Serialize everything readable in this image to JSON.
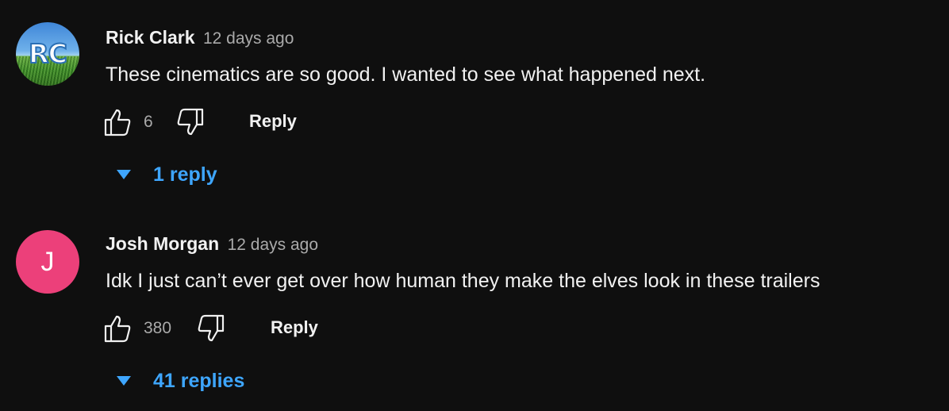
{
  "comments": [
    {
      "author": "Rick Clark",
      "time": "12 days ago",
      "text": "These cinematics are so good. I wanted to see what happened next.",
      "avatar_monogram": "RC",
      "likes": "6",
      "reply_label": "Reply",
      "replies_label": "1 reply",
      "like_icon": "thumbs-up-icon",
      "dislike_icon": "thumbs-down-icon",
      "toggle_icon": "caret-down-icon"
    },
    {
      "author": "Josh Morgan",
      "time": "12 days ago",
      "text": "Idk I just can’t ever get over how human they make the elves look in these trailers",
      "avatar_letter": "J",
      "avatar_color": "#ec407a",
      "likes": "380",
      "reply_label": "Reply",
      "replies_label": "41 replies",
      "like_icon": "thumbs-up-icon",
      "dislike_icon": "thumbs-down-icon",
      "toggle_icon": "caret-down-icon"
    }
  ],
  "colors": {
    "background": "#0f0f0f",
    "text_primary": "#f1f1f1",
    "text_secondary": "#aaaaaa",
    "link_blue": "#3ea6ff"
  }
}
